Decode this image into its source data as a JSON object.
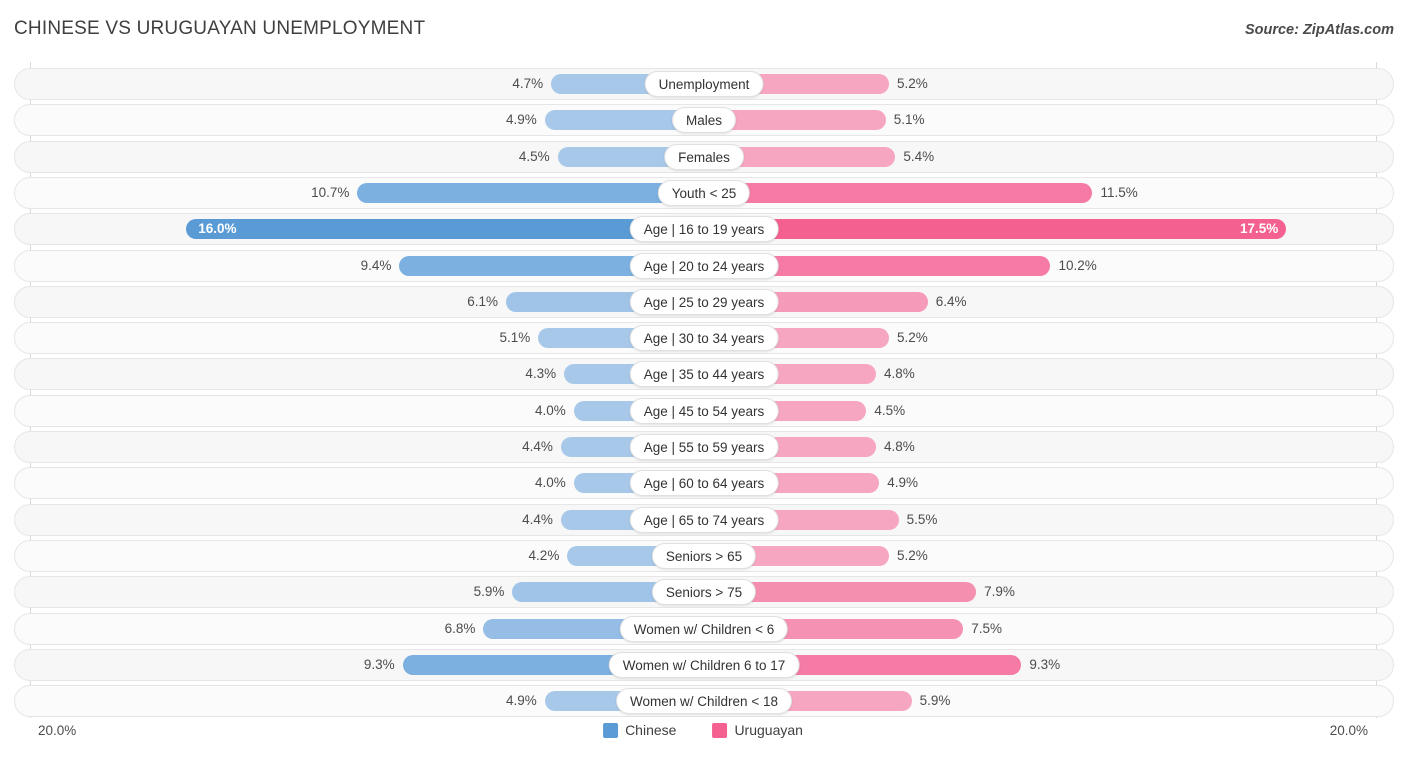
{
  "header": {
    "title": "CHINESE VS URUGUAYAN UNEMPLOYMENT",
    "source": "Source: ZipAtlas.com"
  },
  "legend": {
    "left": {
      "label": "Chinese",
      "color": "#5b9bd5"
    },
    "right": {
      "label": "Uruguayan",
      "color": "#f4608f"
    }
  },
  "axis": {
    "left_max_label": "20.0%",
    "right_max_label": "20.0%",
    "max": 20.0
  },
  "chart_data": {
    "type": "bar",
    "subtype": "diverging-bidirectional",
    "title": "CHINESE VS URUGUAYAN UNEMPLOYMENT",
    "xlabel": "",
    "ylabel": "",
    "xlim": [
      20.0,
      20.0
    ],
    "grid": false,
    "legend_position": "bottom-center",
    "categories": [
      "Unemployment",
      "Males",
      "Females",
      "Youth < 25",
      "Age | 16 to 19 years",
      "Age | 20 to 24 years",
      "Age | 25 to 29 years",
      "Age | 30 to 34 years",
      "Age | 35 to 44 years",
      "Age | 45 to 54 years",
      "Age | 55 to 59 years",
      "Age | 60 to 64 years",
      "Age | 65 to 74 years",
      "Seniors > 65",
      "Seniors > 75",
      "Women w/ Children < 6",
      "Women w/ Children 6 to 17",
      "Women w/ Children < 18"
    ],
    "series": [
      {
        "name": "Chinese",
        "color": "#5b9bd5",
        "values": [
          4.7,
          4.9,
          4.5,
          10.7,
          16.0,
          9.4,
          6.1,
          5.1,
          4.3,
          4.0,
          4.4,
          4.0,
          4.4,
          4.2,
          5.9,
          6.8,
          9.3,
          4.9
        ],
        "labels": [
          "4.7%",
          "4.9%",
          "4.5%",
          "10.7%",
          "16.0%",
          "9.4%",
          "6.1%",
          "5.1%",
          "4.3%",
          "4.0%",
          "4.4%",
          "4.0%",
          "4.4%",
          "4.2%",
          "5.9%",
          "6.8%",
          "9.3%",
          "4.9%"
        ]
      },
      {
        "name": "Uruguayan",
        "color": "#f4608f",
        "values": [
          5.2,
          5.1,
          5.4,
          11.5,
          17.5,
          10.2,
          6.4,
          5.2,
          4.8,
          4.5,
          4.8,
          4.9,
          5.5,
          5.2,
          7.9,
          7.5,
          9.3,
          5.9
        ],
        "labels": [
          "5.2%",
          "5.1%",
          "5.4%",
          "11.5%",
          "17.5%",
          "10.2%",
          "6.4%",
          "5.2%",
          "4.8%",
          "4.5%",
          "4.8%",
          "4.9%",
          "5.5%",
          "5.2%",
          "7.9%",
          "7.5%",
          "9.3%",
          "5.9%"
        ]
      }
    ]
  },
  "rows": [
    {
      "label": "Unemployment",
      "left_value": 4.7,
      "left_label": "4.7%",
      "left_color": "#a8c8ea",
      "right_value": 5.2,
      "right_label": "5.2%",
      "right_color": "#f6a6c1",
      "label_inside": false
    },
    {
      "label": "Males",
      "left_value": 4.9,
      "left_label": "4.9%",
      "left_color": "#a8c8ea",
      "right_value": 5.1,
      "right_label": "5.1%",
      "right_color": "#f6a6c1",
      "label_inside": false
    },
    {
      "label": "Females",
      "left_value": 4.5,
      "left_label": "4.5%",
      "left_color": "#a8c8ea",
      "right_value": 5.4,
      "right_label": "5.4%",
      "right_color": "#f6a6c1",
      "label_inside": false
    },
    {
      "label": "Youth < 25",
      "left_value": 10.7,
      "left_label": "10.7%",
      "left_color": "#7cb0e0",
      "right_value": 11.5,
      "right_label": "11.5%",
      "right_color": "#f57ba6",
      "label_inside": false
    },
    {
      "label": "Age | 16 to 19 years",
      "left_value": 16.0,
      "left_label": "16.0%",
      "left_color": "#5b9bd5",
      "right_value": 17.5,
      "right_label": "17.5%",
      "right_color": "#f4608f",
      "label_inside": true
    },
    {
      "label": "Age | 20 to 24 years",
      "left_value": 9.4,
      "left_label": "9.4%",
      "left_color": "#7cb0e0",
      "right_value": 10.2,
      "right_label": "10.2%",
      "right_color": "#f57ba6",
      "label_inside": false
    },
    {
      "label": "Age | 25 to 29 years",
      "left_value": 6.1,
      "left_label": "6.1%",
      "left_color": "#a0c3e8",
      "right_value": 6.4,
      "right_label": "6.4%",
      "right_color": "#f69ab9",
      "label_inside": false
    },
    {
      "label": "Age | 30 to 34 years",
      "left_value": 5.1,
      "left_label": "5.1%",
      "left_color": "#a8c8ea",
      "right_value": 5.2,
      "right_label": "5.2%",
      "right_color": "#f6a6c1",
      "label_inside": false
    },
    {
      "label": "Age | 35 to 44 years",
      "left_value": 4.3,
      "left_label": "4.3%",
      "left_color": "#a8c8ea",
      "right_value": 4.8,
      "right_label": "4.8%",
      "right_color": "#f6a6c1",
      "label_inside": false
    },
    {
      "label": "Age | 45 to 54 years",
      "left_value": 4.0,
      "left_label": "4.0%",
      "left_color": "#a8c8ea",
      "right_value": 4.5,
      "right_label": "4.5%",
      "right_color": "#f6a6c1",
      "label_inside": false
    },
    {
      "label": "Age | 55 to 59 years",
      "left_value": 4.4,
      "left_label": "4.4%",
      "left_color": "#a8c8ea",
      "right_value": 4.8,
      "right_label": "4.8%",
      "right_color": "#f6a6c1",
      "label_inside": false
    },
    {
      "label": "Age | 60 to 64 years",
      "left_value": 4.0,
      "left_label": "4.0%",
      "left_color": "#a8c8ea",
      "right_value": 4.9,
      "right_label": "4.9%",
      "right_color": "#f6a6c1",
      "label_inside": false
    },
    {
      "label": "Age | 65 to 74 years",
      "left_value": 4.4,
      "left_label": "4.4%",
      "left_color": "#a8c8ea",
      "right_value": 5.5,
      "right_label": "5.5%",
      "right_color": "#f6a6c1",
      "label_inside": false
    },
    {
      "label": "Seniors > 65",
      "left_value": 4.2,
      "left_label": "4.2%",
      "left_color": "#a8c8ea",
      "right_value": 5.2,
      "right_label": "5.2%",
      "right_color": "#f6a6c1",
      "label_inside": false
    },
    {
      "label": "Seniors > 75",
      "left_value": 5.9,
      "left_label": "5.9%",
      "left_color": "#a0c3e8",
      "right_value": 7.9,
      "right_label": "7.9%",
      "right_color": "#f58fb0",
      "label_inside": false
    },
    {
      "label": "Women w/ Children < 6",
      "left_value": 6.8,
      "left_label": "6.8%",
      "left_color": "#96bde6",
      "right_value": 7.5,
      "right_label": "7.5%",
      "right_color": "#f591b2",
      "label_inside": false
    },
    {
      "label": "Women w/ Children 6 to 17",
      "left_value": 9.3,
      "left_label": "9.3%",
      "left_color": "#7cb0e0",
      "right_value": 9.3,
      "right_label": "9.3%",
      "right_color": "#f57ba6",
      "label_inside": false
    },
    {
      "label": "Women w/ Children < 18",
      "left_value": 4.9,
      "left_label": "4.9%",
      "left_color": "#a8c8ea",
      "right_value": 5.9,
      "right_label": "5.9%",
      "right_color": "#f6a6c1",
      "label_inside": false
    }
  ]
}
